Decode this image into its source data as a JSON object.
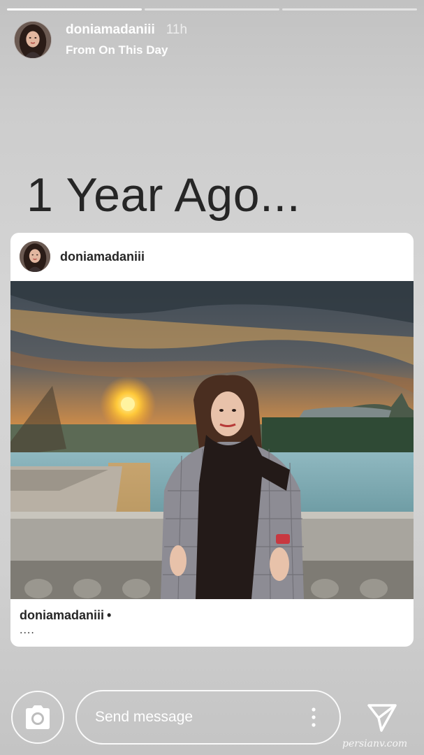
{
  "story": {
    "progress": [
      1.0,
      0.0,
      0.0
    ],
    "username": "doniamadaniii",
    "time": "11h",
    "subtitle": "From On This Day",
    "avatar_icon": "profile-avatar"
  },
  "title": "1 Year Ago...",
  "post": {
    "username": "doniamadaniii",
    "caption_username": "doniamadaniii",
    "caption_dot": "•",
    "caption": "....",
    "photo_description_icon": "post-photo"
  },
  "reply_bar": {
    "camera_icon": "camera-icon",
    "message_placeholder": "Send message",
    "more_icon": "more-vertical-icon",
    "send_icon": "send-icon"
  },
  "watermark": "persianv.com"
}
